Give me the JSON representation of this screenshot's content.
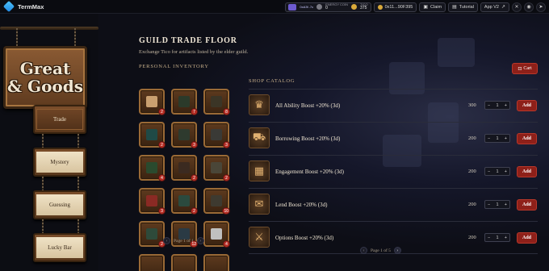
{
  "topbar": {
    "brand": "TermMax",
    "account_badge": "0xA3f..7c",
    "energy_label": "ENERGY COIN",
    "energy_value": "0",
    "tico_label": "TICO",
    "tico_value": "375",
    "wallet": "0x11...90F395",
    "claim": "Claim",
    "tutorial": "Tutorial",
    "app": "App V2",
    "social": [
      "x-icon",
      "discord-icon",
      "telegram-icon"
    ]
  },
  "nav": {
    "sign_line1": "Great",
    "sign_line2": "& Goods",
    "items": [
      {
        "label": "Trade",
        "active": true
      },
      {
        "label": "Mystery",
        "active": false
      },
      {
        "label": "Guessing",
        "active": false
      },
      {
        "label": "Lucky Bar",
        "active": false
      }
    ]
  },
  "page": {
    "title": "GUILD TRADE FLOOR",
    "subtitle": "Exchange Tico for artifacts listed by the elder guild."
  },
  "inventory": {
    "label": "PERSONAL INVENTORY",
    "slots": [
      {
        "count": "2",
        "color": "#c9a070"
      },
      {
        "count": "7",
        "color": "#2b3a2a"
      },
      {
        "count": "8",
        "color": "#3b3526"
      },
      {
        "count": "2",
        "color": "#1f4a46"
      },
      {
        "count": "3",
        "color": "#2e3a2e"
      },
      {
        "count": "3",
        "color": "#3a3a36"
      },
      {
        "count": "4",
        "color": "#2a4a2e"
      },
      {
        "count": "2",
        "color": "#3b2a20"
      },
      {
        "count": "2",
        "color": "#4a4638"
      },
      {
        "count": "3",
        "color": "#8a2a24"
      },
      {
        "count": "2",
        "color": "#2b4a3e"
      },
      {
        "count": "10",
        "color": "#3e3a30"
      },
      {
        "count": "2",
        "color": "#2e4a3a"
      },
      {
        "count": "12",
        "color": "#2a3a44"
      },
      {
        "count": "4",
        "color": "#c0c0c0"
      },
      {
        "count": "",
        "color": ""
      },
      {
        "count": "",
        "color": ""
      },
      {
        "count": "",
        "color": ""
      }
    ],
    "pager": "Page 1 of 1"
  },
  "catalog": {
    "label": "SHOP CATALOG",
    "cart": "Cart",
    "pager": "Page 1 of 5",
    "rows": [
      {
        "name": "All Ability Boost +20% (3d)",
        "price": "300",
        "qty": "1",
        "add": "Add",
        "icon": "trophy-icon"
      },
      {
        "name": "Borrowing Boost +20% (3d)",
        "price": "200",
        "qty": "1",
        "add": "Add",
        "icon": "cart-icon"
      },
      {
        "name": "Engagement Boost +20% (3d)",
        "price": "200",
        "qty": "1",
        "add": "Add",
        "icon": "chest-icon"
      },
      {
        "name": "Lend Boost +20% (3d)",
        "price": "200",
        "qty": "1",
        "add": "Add",
        "icon": "scroll-icon"
      },
      {
        "name": "Options Boost +20% (3d)",
        "price": "200",
        "qty": "1",
        "add": "Add",
        "icon": "crossed-swords-icon"
      }
    ]
  }
}
